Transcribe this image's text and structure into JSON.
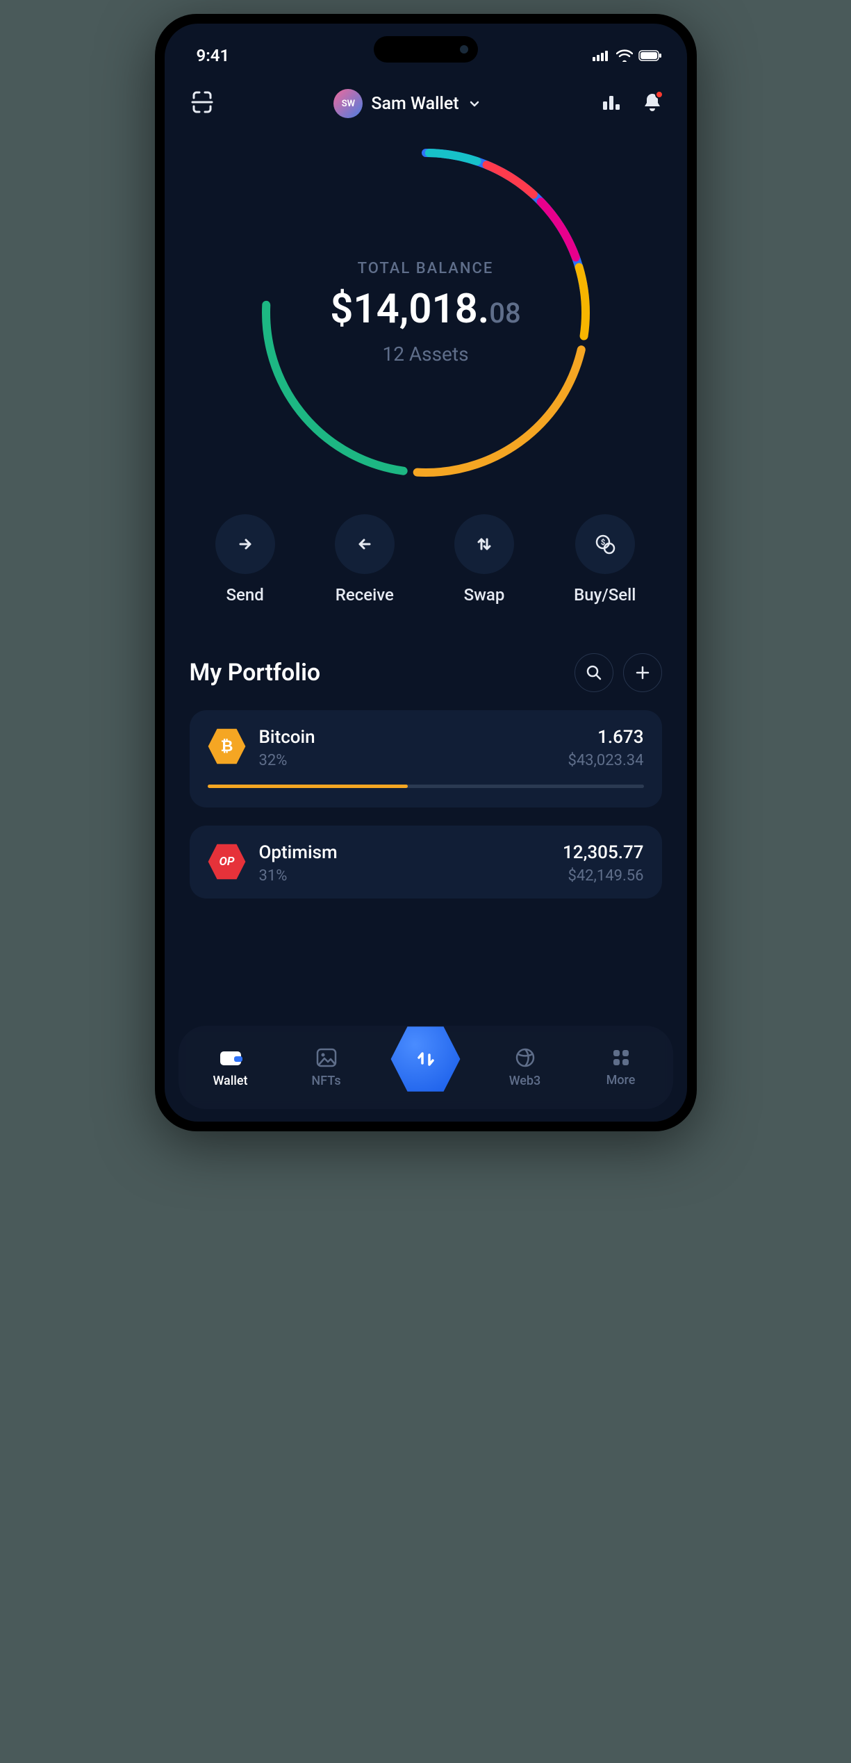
{
  "status": {
    "time": "9:41"
  },
  "header": {
    "avatar_initials": "SW",
    "wallet_name": "Sam Wallet"
  },
  "balance": {
    "label": "TOTAL BALANCE",
    "amount_main": "$14,018.",
    "amount_cents": "08",
    "assets": "12 Assets"
  },
  "donut_colors": {
    "seg1": "#2f72f7",
    "seg2": "#1db783",
    "seg3": "#f5a623",
    "seg4": "#f7b500",
    "seg5": "#e7008c",
    "seg6": "#ff3b4d",
    "seg7": "#17c1c9"
  },
  "actions": {
    "send": "Send",
    "receive": "Receive",
    "swap": "Swap",
    "buysell": "Buy/Sell"
  },
  "portfolio": {
    "title": "My Portfolio",
    "assets": [
      {
        "name": "Bitcoin",
        "pct": "32%",
        "amount": "1.673",
        "value": "$43,023.34",
        "bar_pct": 46,
        "bar_color": "#f5a623",
        "icon_bg": "#f5a623",
        "icon_label": "₿"
      },
      {
        "name": "Optimism",
        "pct": "31%",
        "amount": "12,305.77",
        "value": "$42,149.56",
        "bar_pct": 0,
        "bar_color": "#ff3b4d",
        "icon_bg": "#e6323a",
        "icon_label": "OP"
      }
    ]
  },
  "nav": {
    "wallet": "Wallet",
    "nfts": "NFTs",
    "web3": "Web3",
    "more": "More"
  }
}
